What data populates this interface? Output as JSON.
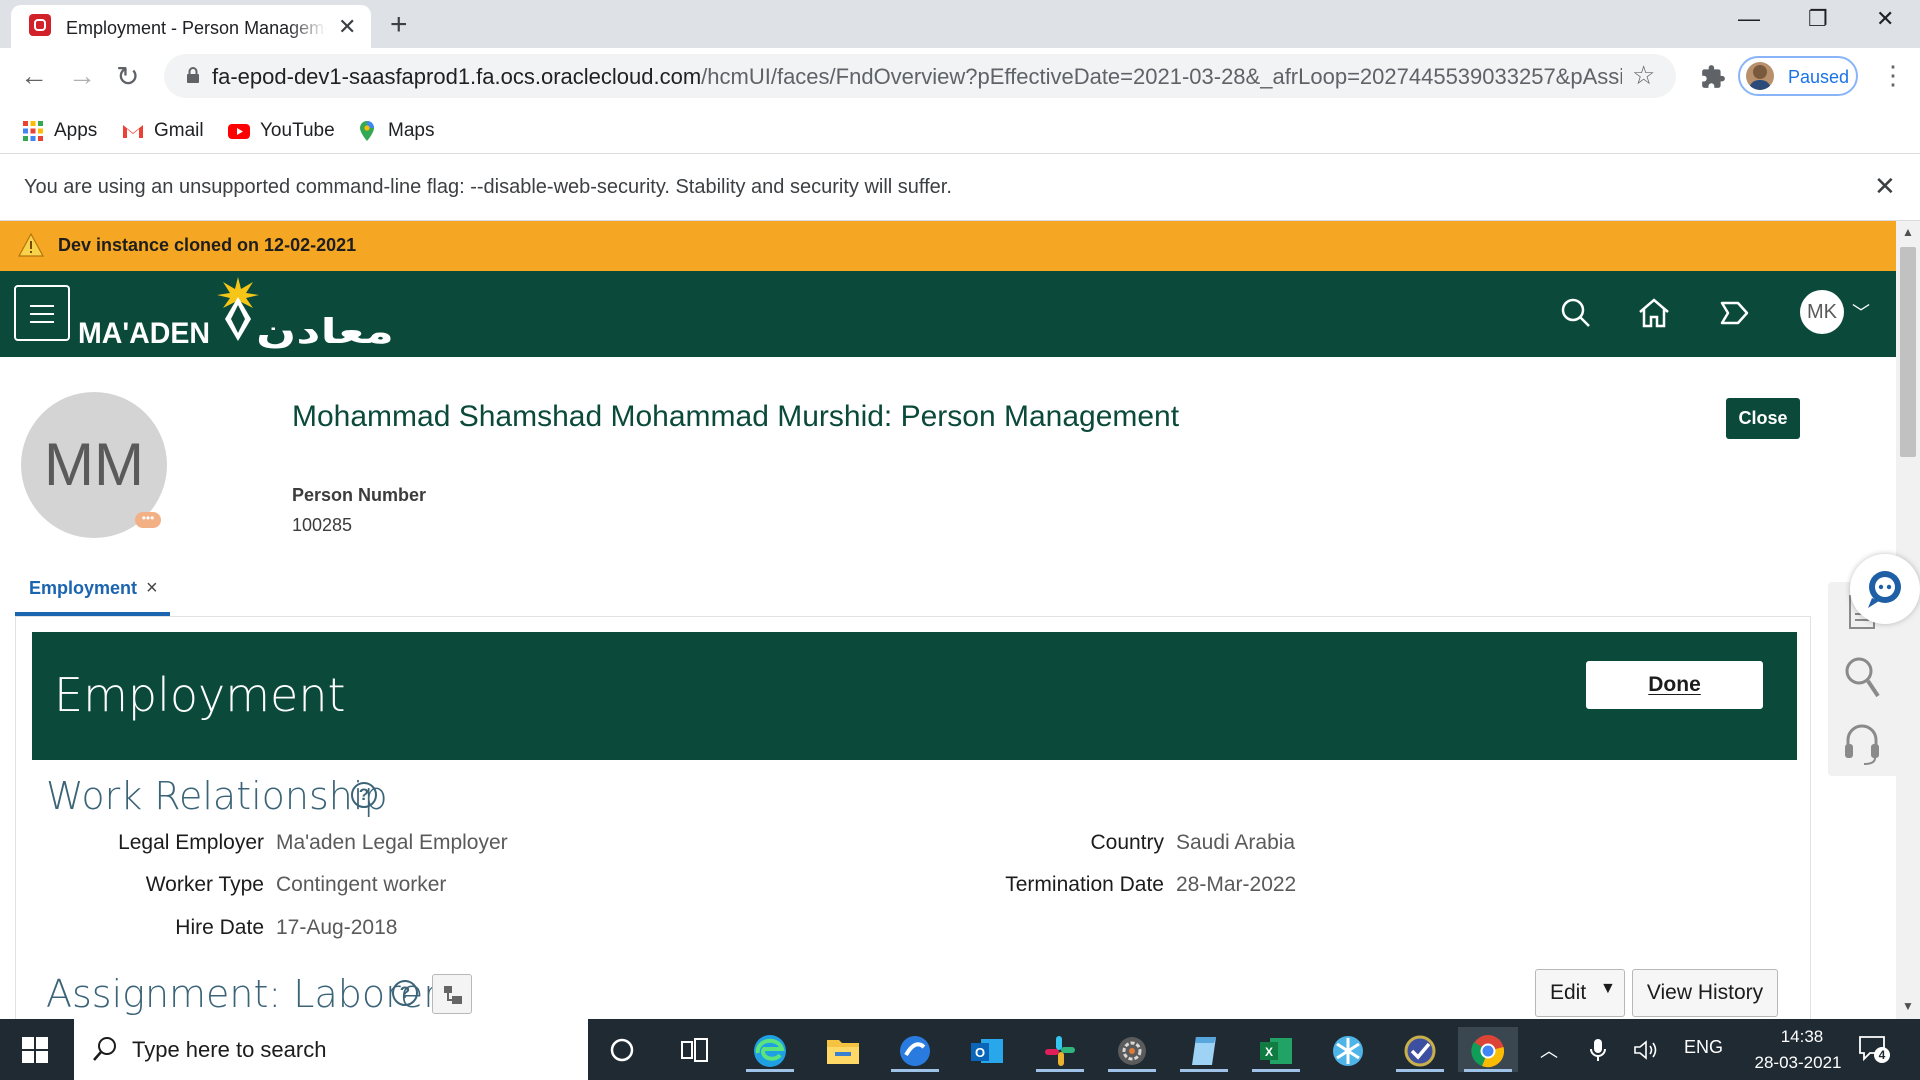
{
  "browser": {
    "tab_title": "Employment - Person Management",
    "url_host": "fa-epod-dev1-saasfaprod1.fa.ocs.oraclecloud.com",
    "url_path": "/hcmUI/faces/FndOverview?pEffectiveDate=2021-03-28&_afrLoop=2027445539033257&pAssignme...",
    "profile_label": "Paused",
    "bookmarks": [
      {
        "label": "Apps",
        "icon": "apps-grid-icon"
      },
      {
        "label": "Gmail",
        "icon": "gmail-icon"
      },
      {
        "label": "YouTube",
        "icon": "youtube-icon"
      },
      {
        "label": "Maps",
        "icon": "maps-pin-icon"
      }
    ],
    "infobar_text": "You are using an unsupported command-line flag: --disable-web-security. Stability and security will suffer."
  },
  "app": {
    "dev_banner": "Dev instance cloned on 12-02-2021",
    "logo_text_en": "MA'ADEN",
    "logo_text_ar": "معادن",
    "user_initials": "MK",
    "colors": {
      "header": "#0b4a3a",
      "banner": "#f5a623",
      "link": "#1a64b0"
    }
  },
  "person": {
    "initials": "MM",
    "title": "Mohammad Shamshad Mohammad Murshid: Person Management",
    "person_number_label": "Person Number",
    "person_number": "100285",
    "close_label": "Close"
  },
  "tabs": [
    {
      "label": "Employment",
      "close": "×"
    }
  ],
  "employment": {
    "heading": "Employment",
    "done_label": "Done",
    "work_relationship": {
      "title": "Work Relationship",
      "left": [
        {
          "label": "Legal Employer",
          "value": "Ma'aden Legal Employer"
        },
        {
          "label": "Worker Type",
          "value": "Contingent worker"
        },
        {
          "label": "Hire Date",
          "value": "17-Aug-2018"
        }
      ],
      "right": [
        {
          "label": "Country",
          "value": "Saudi Arabia"
        },
        {
          "label": "Termination Date",
          "value": "28-Mar-2022"
        }
      ]
    },
    "assignment": {
      "title": "Assignment: Laborer",
      "edit_label": "Edit",
      "view_history_label": "View History"
    }
  },
  "taskbar": {
    "search_placeholder": "Type here to search",
    "language": "ENG",
    "time": "14:38",
    "date": "28-03-2021",
    "notification_count": "4"
  }
}
